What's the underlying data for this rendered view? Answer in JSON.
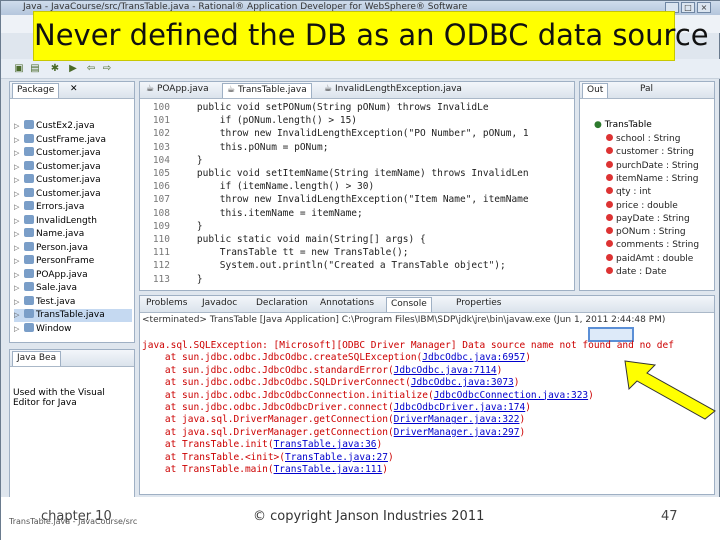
{
  "slide": {
    "title": "Never defined the DB as an ODBC data source",
    "footer_chapter": "chapter 10",
    "footer_copyright": "© copyright Janson Industries 2011",
    "footer_page": "47"
  },
  "window": {
    "title": "Java - JavaCourse/src/TransTable.java - Rational® Application Developer for WebSphere® Software"
  },
  "package_explorer": {
    "tab": "Package",
    "items": [
      "CustEx2.java",
      "CustFrame.java",
      "Customer.java",
      "Customer.java",
      "Customer.java",
      "Customer.java",
      "Errors.java",
      "InvalidLength",
      "Name.java",
      "Person.java",
      "PersonFrame",
      "POApp.java",
      "Sale.java",
      "Test.java",
      "TransTable.java",
      "Window"
    ]
  },
  "bean_panel": {
    "tab": "Java Bea",
    "text": "Used with the Visual Editor for Java"
  },
  "editor": {
    "tabs": [
      "POApp.java",
      "TransTable.java",
      "InvalidLengthException.java"
    ],
    "lines": [
      {
        "num": "100",
        "code": "    public void setPONum(String pONum) throws InvalidLe"
      },
      {
        "num": "101",
        "code": "        if (pONum.length() > 15)"
      },
      {
        "num": "102",
        "code": "        throw new InvalidLengthException(\"PO Number\", pONum, 1"
      },
      {
        "num": "103",
        "code": "        this.pONum = pONum;"
      },
      {
        "num": "104",
        "code": "    }"
      },
      {
        "num": "105",
        "code": "    public void setItemName(String itemName) throws InvalidLen"
      },
      {
        "num": "106",
        "code": "        if (itemName.length() > 30)"
      },
      {
        "num": "107",
        "code": "        throw new InvalidLengthException(\"Item Name\", itemName"
      },
      {
        "num": "108",
        "code": "        this.itemName = itemName;"
      },
      {
        "num": "109",
        "code": "    }"
      },
      {
        "num": "110",
        "code": "    public static void main(String[] args) {"
      },
      {
        "num": "111",
        "code": "        TransTable tt = new TransTable();"
      },
      {
        "num": "112",
        "code": "        System.out.println(\"Created a TransTable object\");"
      },
      {
        "num": "113",
        "code": "    }"
      }
    ]
  },
  "outline": {
    "tabs": [
      "Out",
      "Pal"
    ],
    "root": "TransTable",
    "items": [
      "school : String",
      "customer : String",
      "purchDate : String",
      "itemName : String",
      "qty : int",
      "price : double",
      "payDate : String",
      "pONum : String",
      "comments : String",
      "paidAmt : double",
      "date : Date"
    ]
  },
  "console": {
    "tabs": [
      "Problems",
      "Javadoc",
      "Declaration",
      "Annotations",
      "Console",
      "Properties"
    ],
    "header": "<terminated> TransTable [Java Application] C:\\Program Files\\IBM\\SDP\\jdk\\jre\\bin\\javaw.exe (Jun 1, 2011 2:44:48 PM)",
    "lines": [
      {
        "pre": "java.sql.SQLException: [Microsoft][ODBC Driver Manager] Data source name not found and no def",
        "link": ""
      },
      {
        "pre": "    at sun.jdbc.odbc.JdbcOdbc.createSQLException(",
        "link": "JdbcOdbc.java:6957",
        "post": ")"
      },
      {
        "pre": "    at sun.jdbc.odbc.JdbcOdbc.standardError(",
        "link": "JdbcOdbc.java:7114",
        "post": ")"
      },
      {
        "pre": "    at sun.jdbc.odbc.JdbcOdbc.SQLDriverConnect(",
        "link": "JdbcOdbc.java:3073",
        "post": ")"
      },
      {
        "pre": "    at sun.jdbc.odbc.JdbcOdbcConnection.initialize(",
        "link": "JdbcOdbcConnection.java:323",
        "post": ")"
      },
      {
        "pre": "    at sun.jdbc.odbc.JdbcOdbcDriver.connect(",
        "link": "JdbcOdbcDriver.java:174",
        "post": ")"
      },
      {
        "pre": "    at java.sql.DriverManager.getConnection(",
        "link": "DriverManager.java:322",
        "post": ")"
      },
      {
        "pre": "    at java.sql.DriverManager.getConnection(",
        "link": "DriverManager.java:297",
        "post": ")"
      },
      {
        "pre": "    at TransTable.init(",
        "link": "TransTable.java:36",
        "post": ")"
      },
      {
        "pre": "    at TransTable.<init>(",
        "link": "TransTable.java:27",
        "post": ")"
      },
      {
        "pre": "    at TransTable.main(",
        "link": "TransTable.java:111",
        "post": ")"
      }
    ]
  },
  "status_bar": "TransTable.java - JavaCourse/src"
}
